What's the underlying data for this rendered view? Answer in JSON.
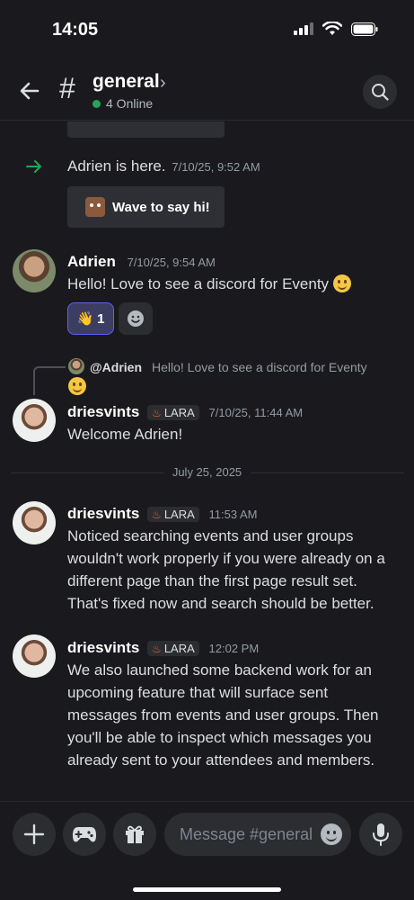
{
  "status": {
    "time": "14:05"
  },
  "header": {
    "hash": "#",
    "channel": "general",
    "chevron": "›",
    "online": "4 Online"
  },
  "join": {
    "user": "Adrien",
    "text": " is here.",
    "ts": "7/10/25, 9:52 AM",
    "wave_label": "Wave to say hi!"
  },
  "messages": [
    {
      "user": "Adrien",
      "ts": "7/10/25, 9:54 AM",
      "text": "Hello! Love to see a discord for Eventy",
      "reaction_emoji": "👋",
      "reaction_count": "1"
    },
    {
      "reply_user": "@Adrien",
      "reply_text": "Hello! Love to see a discord for Eventy",
      "user": "driesvints",
      "tag": "LARA",
      "ts": "7/10/25, 11:44 AM",
      "text": "Welcome Adrien!"
    },
    {
      "user": "driesvints",
      "tag": "LARA",
      "ts": "11:53 AM",
      "text": "Noticed searching events and user groups wouldn't work properly if you were already on a different page than the first page result set. That's fixed now and search should be better."
    },
    {
      "user": "driesvints",
      "tag": "LARA",
      "ts": "12:02 PM",
      "text": "We also launched some backend work for an upcoming feature that will surface sent messages from events and user groups. Then you'll be able to inspect which messages you already sent to your attendees and members."
    }
  ],
  "divider": "July 25, 2025",
  "composer": {
    "placeholder": "Message #general"
  },
  "colors": {
    "online": "#23a55a",
    "accent": "#5865f2",
    "join_arrow": "#23a55a",
    "tag_flame": "#f0682c"
  },
  "icons": [
    "back-arrow-icon",
    "hash-icon",
    "search-icon",
    "plus-icon",
    "gamepad-icon",
    "gift-icon",
    "emoji-icon",
    "microphone-icon",
    "join-arrow-icon",
    "add-reaction-icon"
  ]
}
